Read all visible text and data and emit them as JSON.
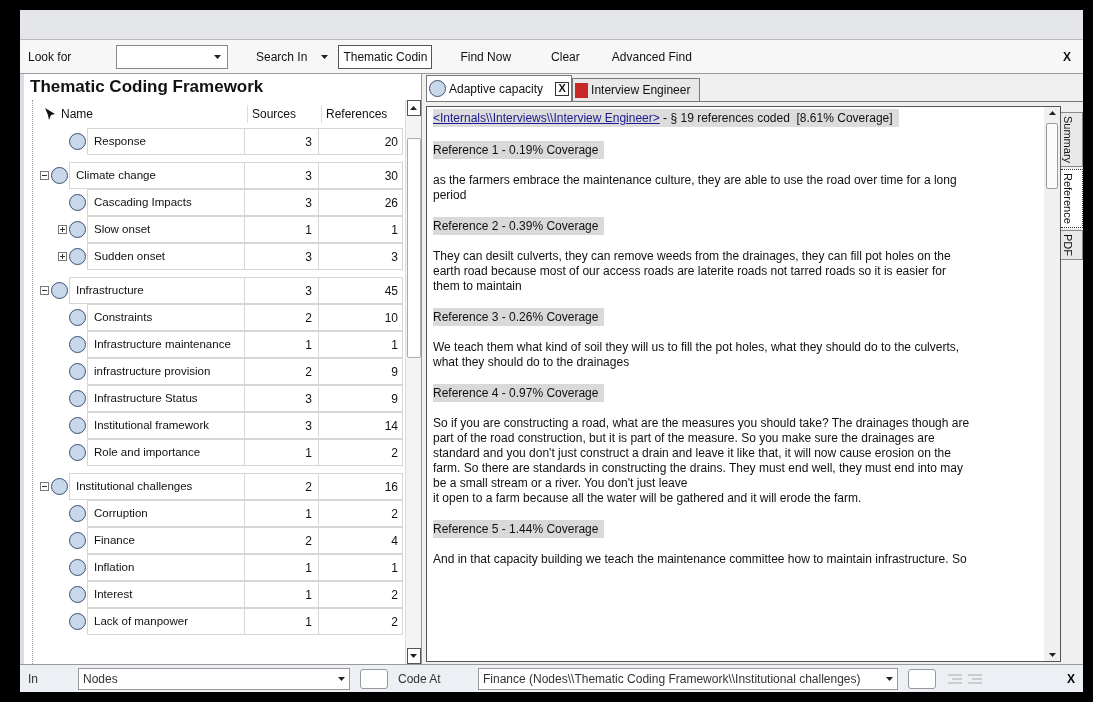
{
  "find_bar": {
    "look_for_label": "Look for",
    "search_in_label": "Search In",
    "search_in_value": "Thematic Codin",
    "find_now": "Find Now",
    "clear": "Clear",
    "advanced_find": "Advanced Find",
    "close": "X"
  },
  "tree": {
    "title": "Thematic Coding Framework",
    "columns": [
      "Name",
      "Sources",
      "References"
    ],
    "nodes": [
      {
        "children": [
          {
            "name": "Response",
            "sources": "3",
            "references": "20"
          }
        ]
      },
      {
        "name": "Climate change",
        "sources": "3",
        "references": "30",
        "expanded": true,
        "children": [
          {
            "name": "Cascading Impacts",
            "sources": "3",
            "references": "26"
          },
          {
            "name": "Slow onset",
            "sources": "1",
            "references": "1",
            "expanded": false
          },
          {
            "name": "Sudden onset",
            "sources": "3",
            "references": "3",
            "expanded": false
          }
        ]
      },
      {
        "name": "Infrastructure",
        "sources": "3",
        "references": "45",
        "expanded": true,
        "children": [
          {
            "name": "Constraints",
            "sources": "2",
            "references": "10"
          },
          {
            "name": "Infrastructure maintenance",
            "sources": "1",
            "references": "1"
          },
          {
            "name": "infrastructure provision",
            "sources": "2",
            "references": "9"
          },
          {
            "name": "Infrastructure Status",
            "sources": "3",
            "references": "9"
          },
          {
            "name": "Institutional framework",
            "sources": "3",
            "references": "14"
          },
          {
            "name": "Role and importance",
            "sources": "1",
            "references": "2"
          }
        ]
      },
      {
        "name": "Institutional challenges",
        "sources": "2",
        "references": "16",
        "expanded": true,
        "children": [
          {
            "name": "Corruption",
            "sources": "1",
            "references": "2"
          },
          {
            "name": "Finance",
            "sources": "2",
            "references": "4"
          },
          {
            "name": "Inflation",
            "sources": "1",
            "references": "1"
          },
          {
            "name": "Interest",
            "sources": "1",
            "references": "2"
          },
          {
            "name": "Lack of manpower",
            "sources": "1",
            "references": "2"
          }
        ]
      }
    ]
  },
  "tabs": [
    {
      "kind": "node",
      "label": "Adaptive capacity",
      "selected": true,
      "close": "X"
    },
    {
      "kind": "pdf",
      "label": "Interview Engineer",
      "selected": false
    }
  ],
  "content": [
    {
      "kind": "header",
      "link": "<Internals\\\\Interviews\\\\Interview Engineer>",
      "text": " - § 19 references coded  [8.61% Coverage]"
    },
    {
      "kind": "reference",
      "text": "Reference 1 - 0.19% Coverage"
    },
    {
      "kind": "text",
      "text": "as the farmers embrace the maintenance culture, they are able to use the road over time for a long period"
    },
    {
      "kind": "reference",
      "text": "Reference 2 - 0.39% Coverage"
    },
    {
      "kind": "text",
      "text": "They can desilt culverts, they can remove weeds from the drainages, they can fill pot holes on the earth road because most of our access roads are laterite roads not tarred roads so it is easier for them to maintain"
    },
    {
      "kind": "reference",
      "text": "Reference 3 - 0.26% Coverage"
    },
    {
      "kind": "text",
      "text": "We teach them what kind of soil they will us to fill the pot holes, what they should do to the culverts, what they should do to the drainages"
    },
    {
      "kind": "reference",
      "text": "Reference 4 - 0.97% Coverage"
    },
    {
      "kind": "text",
      "text": "So if you are constructing a road, what are the measures you should take? The drainages though are part of the road construction, but it is part of the measure. So you make sure the drainages are standard and you don't just construct a drain and leave it like that, it will now cause erosion on the farm. So there are standards in constructing the drains. They must end well, they must end into may be a small stream or a river. You don't just leave\nit open to a farm because all the water will be gathered and it will erode the farm."
    },
    {
      "kind": "reference",
      "text": "Reference 5 - 1.44% Coverage"
    },
    {
      "kind": "text",
      "text": "And in that capacity building we teach the maintenance committee how to maintain infrastructure. So"
    }
  ],
  "side_tabs": [
    {
      "label": "Summary",
      "selected": false
    },
    {
      "label": "Reference",
      "selected": true
    },
    {
      "label": "PDF",
      "selected": false
    }
  ],
  "code_bar": {
    "in_label": "In",
    "in_value": "Nodes",
    "code_at_label": "Code At",
    "code_at_value": "Finance (Nodes\\\\Thematic Coding Framework\\\\Institutional challenges)",
    "close": "X"
  }
}
